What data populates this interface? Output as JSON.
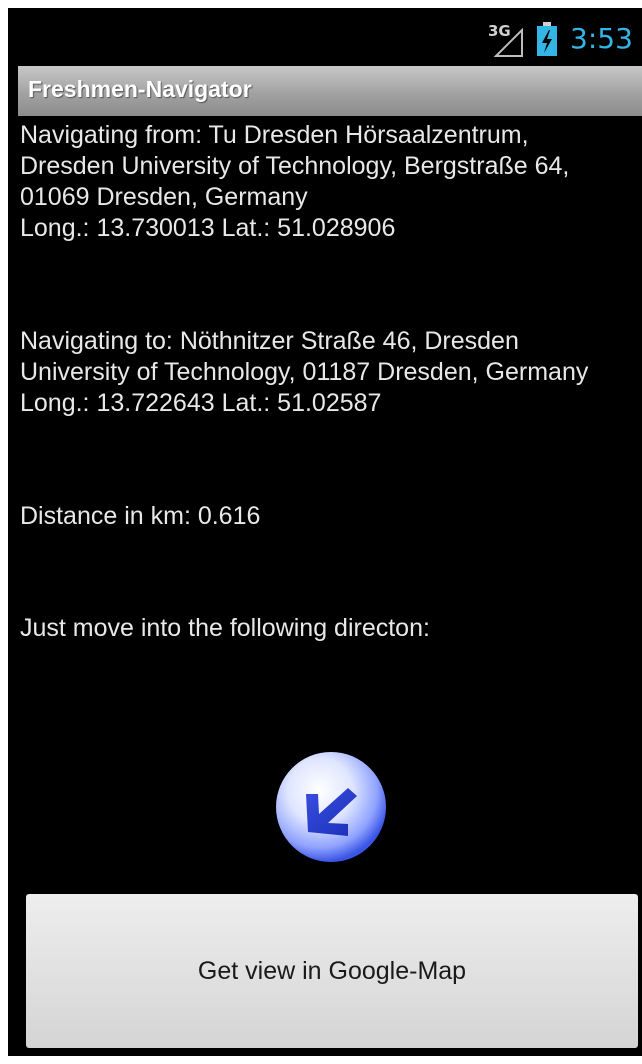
{
  "status_bar": {
    "network": "3G",
    "time": "3:53"
  },
  "app": {
    "title": "Freshmen-Navigator"
  },
  "from": {
    "line1": "Navigating from: Tu Dresden Hörsaalzentrum,",
    "line2": "Dresden University of Technology, Bergstraße 64,",
    "line3": "01069 Dresden, Germany",
    "coords": "Long.: 13.730013 Lat.: 51.028906"
  },
  "to": {
    "line1": "Navigating to: Nöthnitzer Straße 46, Dresden",
    "line2": "University of Technology, 01187 Dresden, Germany",
    "coords": "Long.: 13.722643 Lat.: 51.02587"
  },
  "distance": "Distance in km: 0.616",
  "direction_prompt": "Just move into the following directon:",
  "direction_icon": "arrow-down-left-icon",
  "button": {
    "label": "Get view in Google-Map"
  },
  "colors": {
    "clock": "#33b5e5",
    "background": "#000000",
    "text": "#e8e8e8"
  }
}
